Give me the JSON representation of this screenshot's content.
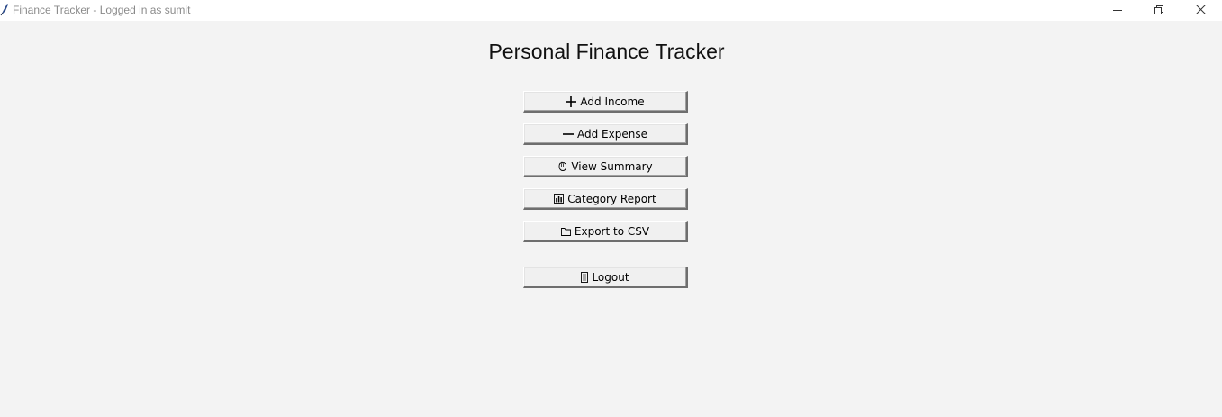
{
  "window": {
    "title": "Finance Tracker - Logged in as sumit",
    "icon": "feather-icon",
    "controls": [
      "minimize-icon",
      "restore-icon",
      "close-icon"
    ]
  },
  "main": {
    "heading": "Personal Finance Tracker",
    "buttons": [
      {
        "label": "Add Income",
        "icon": "plus-icon"
      },
      {
        "label": "Add Expense",
        "icon": "minus-icon"
      },
      {
        "label": "View Summary",
        "icon": "hand-icon"
      },
      {
        "label": "Category Report",
        "icon": "bar-chart-icon"
      },
      {
        "label": "Export to CSV",
        "icon": "folder-icon"
      },
      {
        "label": "Logout",
        "icon": "door-icon"
      }
    ]
  },
  "colors": {
    "background": "#f3f3f3",
    "titlebar": "#ffffff",
    "button_face": "#f0f0f0"
  }
}
